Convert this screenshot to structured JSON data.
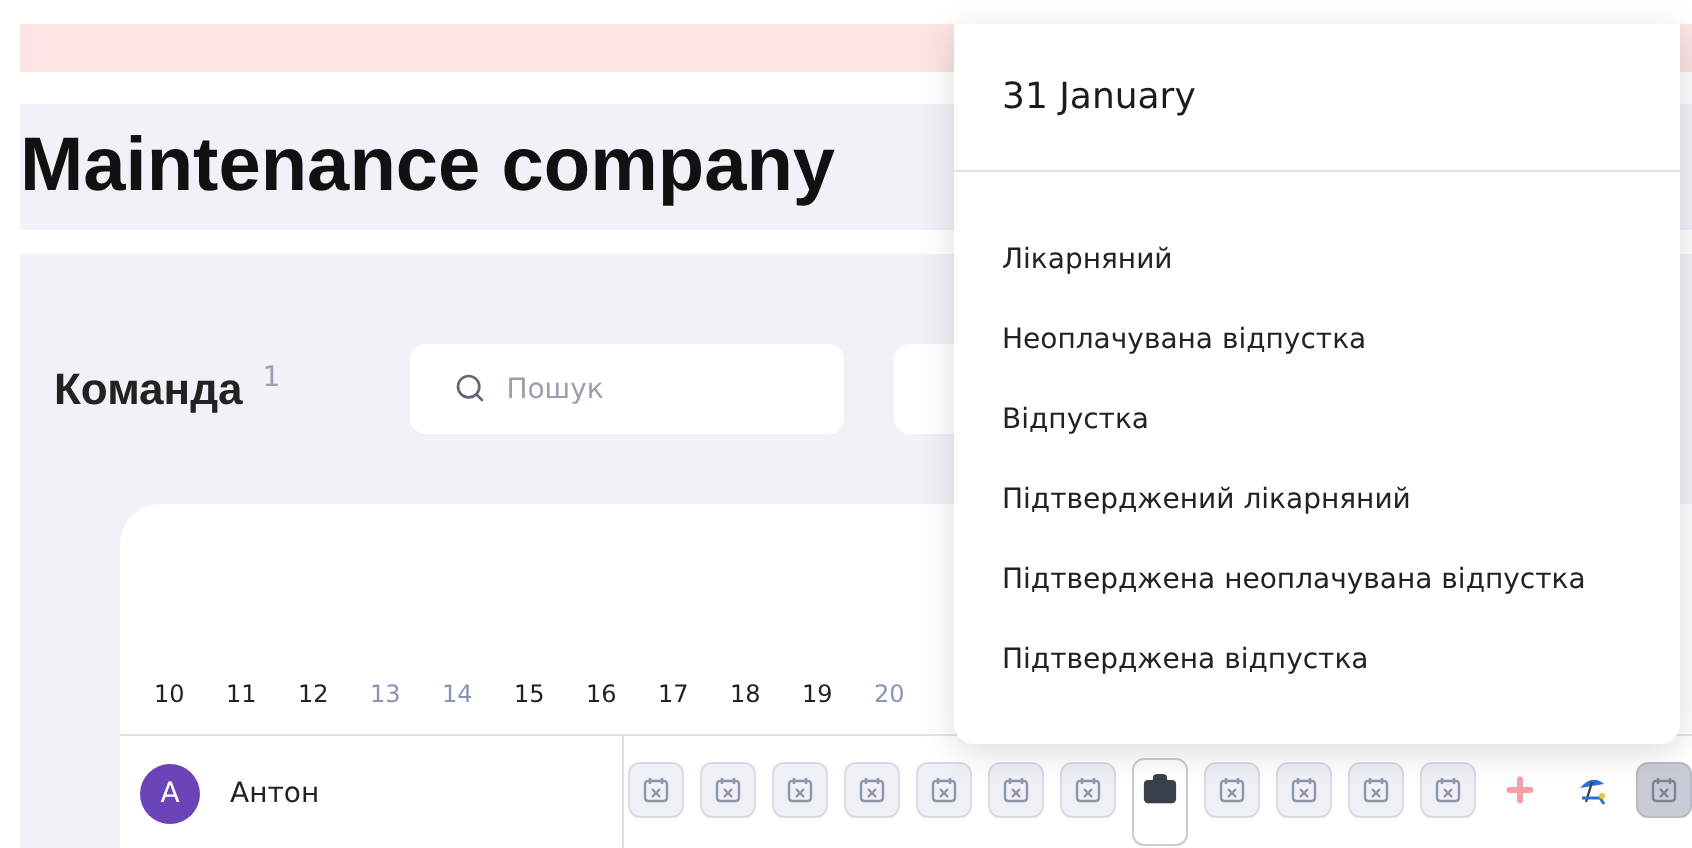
{
  "page_title": "Maintenance company",
  "team": {
    "title": "Команда",
    "count": "1",
    "search": {
      "placeholder": "Пошук"
    }
  },
  "days": [
    {
      "label": "10",
      "weekend": false
    },
    {
      "label": "11",
      "weekend": false
    },
    {
      "label": "12",
      "weekend": false
    },
    {
      "label": "13",
      "weekend": true
    },
    {
      "label": "14",
      "weekend": true
    },
    {
      "label": "15",
      "weekend": false
    },
    {
      "label": "16",
      "weekend": false
    },
    {
      "label": "17",
      "weekend": false
    },
    {
      "label": "18",
      "weekend": false
    },
    {
      "label": "19",
      "weekend": false
    },
    {
      "label": "20",
      "weekend": true
    }
  ],
  "employees": [
    {
      "initial": "A",
      "name": "Антон",
      "cells": [
        {
          "kind": "day-off",
          "selected": false
        },
        {
          "kind": "day-off",
          "selected": false
        },
        {
          "kind": "day-off",
          "selected": false
        },
        {
          "kind": "day-off",
          "selected": false
        },
        {
          "kind": "day-off",
          "selected": false
        },
        {
          "kind": "day-off",
          "selected": false
        },
        {
          "kind": "day-off",
          "selected": false
        },
        {
          "kind": "work",
          "selected": true
        },
        {
          "kind": "day-off",
          "selected": false
        },
        {
          "kind": "day-off",
          "selected": false
        },
        {
          "kind": "day-off",
          "selected": false
        },
        {
          "kind": "day-off",
          "selected": false
        },
        {
          "kind": "sick",
          "selected": false
        },
        {
          "kind": "vacation",
          "selected": false
        },
        {
          "kind": "blocked",
          "selected": false
        }
      ]
    }
  ],
  "popup": {
    "title": "31 January",
    "items": [
      "Лікарняний",
      "Неоплачувана відпустка",
      "Відпустка",
      "Підтверджений лікарняний",
      "Підтверджена неоплачувана відпустка",
      "Підтверджена відпустка"
    ]
  }
}
